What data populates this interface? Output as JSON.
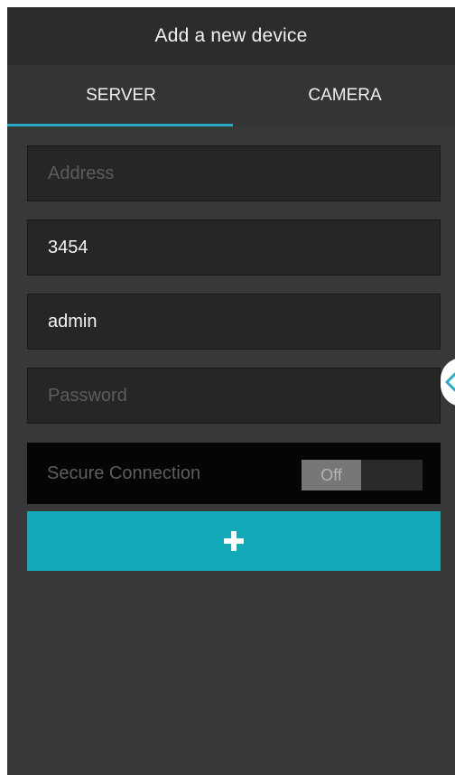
{
  "header": {
    "title": "Add a new device"
  },
  "tabs": [
    {
      "label": "SERVER",
      "selected": true
    },
    {
      "label": "CAMERA",
      "selected": false
    }
  ],
  "form": {
    "address": {
      "value": "",
      "placeholder": "Address"
    },
    "port": {
      "value": "3454"
    },
    "username": {
      "value": "admin"
    },
    "password": {
      "value": "",
      "placeholder": "Password"
    },
    "secure_connection": {
      "label": "Secure Connection",
      "state": "Off"
    }
  },
  "add_button": {
    "icon": "plus-icon"
  },
  "side_handle": {
    "icon": "chevron-left-icon"
  },
  "colors": {
    "accent": "#12aab9",
    "tab_indicator": "#2aa9c9",
    "background": "#383838"
  }
}
